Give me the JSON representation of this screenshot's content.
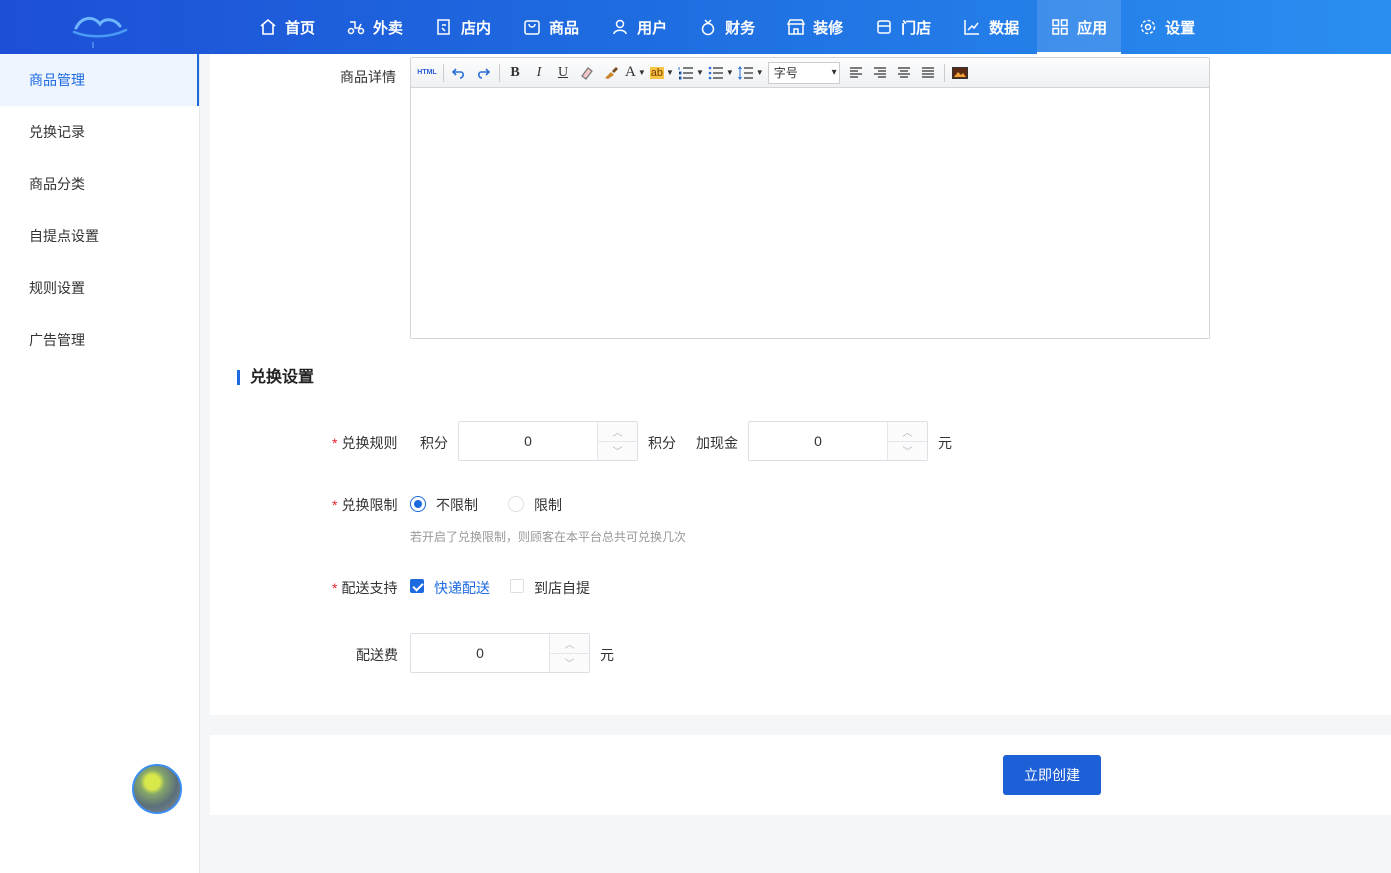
{
  "nav": {
    "items": [
      {
        "label": "首页",
        "icon": "home-icon"
      },
      {
        "label": "外卖",
        "icon": "scooter-icon"
      },
      {
        "label": "店内",
        "icon": "qr-icon"
      },
      {
        "label": "商品",
        "icon": "bag-icon"
      },
      {
        "label": "用户",
        "icon": "user-icon"
      },
      {
        "label": "财务",
        "icon": "moneybag-icon"
      },
      {
        "label": "装修",
        "icon": "shop-icon"
      },
      {
        "label": "门店",
        "icon": "store-icon"
      },
      {
        "label": "数据",
        "icon": "chart-icon"
      },
      {
        "label": "应用",
        "icon": "apps-icon"
      },
      {
        "label": "设置",
        "icon": "gear-icon"
      }
    ],
    "active": "应用"
  },
  "sidebar": {
    "items": [
      {
        "label": "商品管理"
      },
      {
        "label": "兑换记录"
      },
      {
        "label": "商品分类"
      },
      {
        "label": "自提点设置"
      },
      {
        "label": "规则设置"
      },
      {
        "label": "广告管理"
      }
    ],
    "active": "商品管理"
  },
  "form": {
    "detail_label": "商品详情",
    "editor": {
      "html_label": "HTML",
      "bold": "B",
      "italic": "I",
      "underline": "U",
      "font_color": "A",
      "highlight": "ab",
      "fontsize_label": "字号"
    },
    "section_title": "兑换设置",
    "rule": {
      "label": "兑换规则",
      "points_label": "积分",
      "points_value": "0",
      "points_unit": "积分",
      "cash_label": "加现金",
      "cash_value": "0",
      "cash_unit": "元"
    },
    "limit": {
      "label": "兑换限制",
      "option_unlimited": "不限制",
      "option_limited": "限制",
      "selected": "不限制",
      "hint": "若开启了兑换限制，则顾客在本平台总共可兑换几次"
    },
    "delivery": {
      "label": "配送支持",
      "option_express": "快递配送",
      "option_pickup": "到店自提",
      "express_checked": true,
      "pickup_checked": false
    },
    "fee": {
      "label": "配送费",
      "value": "0",
      "unit": "元"
    }
  },
  "submit_label": "立即创建",
  "colors": {
    "primary": "#1d6ae0",
    "required": "#f5222d"
  }
}
